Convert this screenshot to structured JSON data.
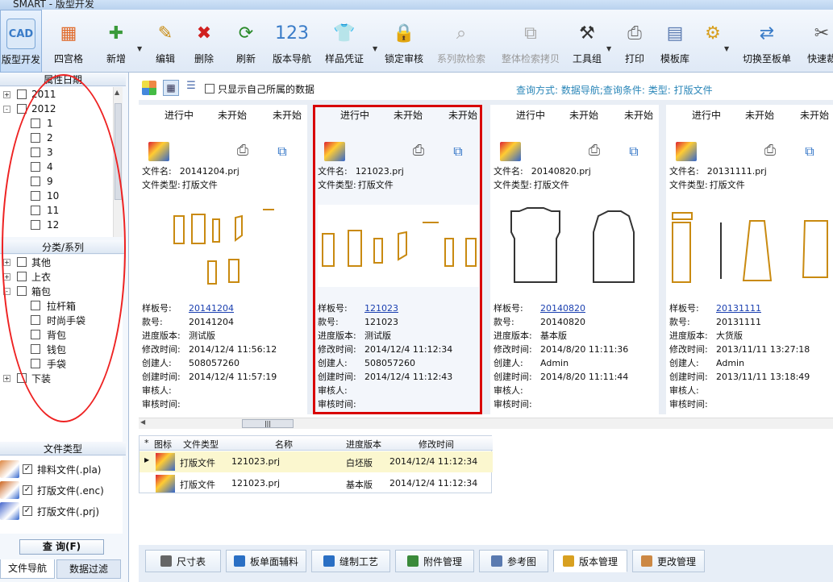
{
  "window": {
    "title": "SMART - 版型开发"
  },
  "toolbar": [
    {
      "label": "版型开发",
      "icon": "cad-icon",
      "active": true
    },
    {
      "label": "四宫格",
      "icon": "grid-four-icon"
    },
    {
      "label": "新增",
      "icon": "new-doc-icon"
    },
    {
      "label": "编辑",
      "icon": "edit-icon"
    },
    {
      "label": "删除",
      "icon": "delete-icon"
    },
    {
      "label": "刷新",
      "icon": "refresh-icon"
    },
    {
      "label": "版本导航",
      "icon": "version-nav-icon"
    },
    {
      "label": "样品凭证",
      "icon": "shirt-icon"
    },
    {
      "label": "锁定审核",
      "icon": "lock-icon"
    },
    {
      "label": "系列款检索",
      "icon": "series-search-icon",
      "disabled": true
    },
    {
      "label": "整体检索拷贝",
      "icon": "copy-icon",
      "disabled": true
    },
    {
      "label": "工具组",
      "icon": "tools-icon"
    },
    {
      "label": "打印",
      "icon": "printer-icon"
    },
    {
      "label": "模板库",
      "icon": "template-icon"
    },
    {
      "label": "",
      "icon": "gear-icon"
    },
    {
      "label": "切换至板单",
      "icon": "switch-icon"
    },
    {
      "label": "快速裁",
      "icon": "scissors-icon"
    }
  ],
  "left": {
    "attr_date_title": "属性日期",
    "date_tree": [
      {
        "label": "2011",
        "level": 0,
        "expander": "+"
      },
      {
        "label": "2012",
        "level": 0,
        "expander": "-"
      },
      {
        "label": "1",
        "level": 1
      },
      {
        "label": "2",
        "level": 1
      },
      {
        "label": "3",
        "level": 1
      },
      {
        "label": "4",
        "level": 1
      },
      {
        "label": "9",
        "level": 1
      },
      {
        "label": "10",
        "level": 1
      },
      {
        "label": "11",
        "level": 1
      },
      {
        "label": "12",
        "level": 1
      }
    ],
    "category_title": "分类/系列",
    "category_tree": [
      {
        "label": "其他",
        "level": 0,
        "expander": "+"
      },
      {
        "label": "上衣",
        "level": 0,
        "expander": "+"
      },
      {
        "label": "箱包",
        "level": 0,
        "expander": "-"
      },
      {
        "label": "拉杆箱",
        "level": 1
      },
      {
        "label": "时尚手袋",
        "level": 1
      },
      {
        "label": "背包",
        "level": 1
      },
      {
        "label": "钱包",
        "level": 1
      },
      {
        "label": "手袋",
        "level": 1
      },
      {
        "label": "下装",
        "level": 0,
        "expander": "+"
      }
    ],
    "filetype_title": "文件类型",
    "file_types": [
      {
        "label": "排料文件(.pla)",
        "checked": true,
        "check_mark": "✓"
      },
      {
        "label": "打版文件(.enc)",
        "checked": true,
        "check_mark": "✓"
      },
      {
        "label": "打版文件(.prj)",
        "checked": true,
        "check_mark": "✓"
      }
    ],
    "query_button": "查 询(F)",
    "tabs": [
      "文件导航",
      "数据过滤"
    ]
  },
  "main": {
    "own_data_label": "只显示自己所属的数据",
    "query_info": "查询方式: 数据导航;查询条件: 类型: 打版文件",
    "cards": [
      {
        "status": [
          "进行中",
          "未开始",
          "未开始"
        ],
        "filename_label": "文件名:",
        "filename": "20141204.prj",
        "filetype_label": "文件类型:",
        "filetype": "打版文件",
        "fields": [
          [
            "样板号:",
            "20141204"
          ],
          [
            "款号:",
            "20141204"
          ],
          [
            "进度版本:",
            "测试版"
          ],
          [
            "修改时间:",
            "2014/12/4 11:56:12"
          ],
          [
            "创建人:",
            "508057260"
          ],
          [
            "创建时间:",
            "2014/12/4 11:57:19"
          ],
          [
            "审核人:",
            ""
          ],
          [
            "审核时间:",
            ""
          ]
        ]
      },
      {
        "status": [
          "进行中",
          "未开始",
          "未开始"
        ],
        "filename_label": "文件名:",
        "filename": "121023.prj",
        "filetype_label": "文件类型:",
        "filetype": "打版文件",
        "selected": true,
        "fields": [
          [
            "样板号:",
            "121023"
          ],
          [
            "款号:",
            "121023"
          ],
          [
            "进度版本:",
            "测试版"
          ],
          [
            "修改时间:",
            "2014/12/4 11:12:34"
          ],
          [
            "创建人:",
            "508057260"
          ],
          [
            "创建时间:",
            "2014/12/4 11:12:43"
          ],
          [
            "审核人:",
            ""
          ],
          [
            "审核时间:",
            ""
          ]
        ]
      },
      {
        "status": [
          "进行中",
          "未开始",
          "未开始"
        ],
        "filename_label": "文件名:",
        "filename": "20140820.prj",
        "filetype_label": "文件类型:",
        "filetype": "打版文件",
        "fields": [
          [
            "样板号:",
            "20140820"
          ],
          [
            "款号:",
            "20140820"
          ],
          [
            "进度版本:",
            "基本版"
          ],
          [
            "修改时间:",
            "2014/8/20 11:11:36"
          ],
          [
            "创建人:",
            "Admin"
          ],
          [
            "创建时间:",
            "2014/8/20 11:11:44"
          ],
          [
            "审核人:",
            ""
          ],
          [
            "审核时间:",
            ""
          ]
        ]
      },
      {
        "status": [
          "进行中",
          "未开始",
          "未开始"
        ],
        "filename_label": "文件名:",
        "filename": "20131111.prj",
        "filetype_label": "文件类型:",
        "filetype": "打版文件",
        "fields": [
          [
            "样板号:",
            "20131111"
          ],
          [
            "款号:",
            "20131111"
          ],
          [
            "进度版本:",
            "大货版"
          ],
          [
            "修改时间:",
            "2013/11/11 13:27:18"
          ],
          [
            "创建人:",
            "Admin"
          ],
          [
            "创建时间:",
            "2013/11/11 13:18:49"
          ],
          [
            "审核人:",
            ""
          ],
          [
            "审核时间:",
            ""
          ]
        ]
      }
    ],
    "grid": {
      "corner": "*",
      "headers": [
        "图标",
        "文件类型",
        "名称",
        "进度版本",
        "修改时间"
      ],
      "rows": [
        {
          "type": "打版文件",
          "name": "121023.prj",
          "version": "白坯版",
          "time": "2014/12/4 11:12:34",
          "current": true
        },
        {
          "type": "打版文件",
          "name": "121023.prj",
          "version": "基本版",
          "time": "2014/12/4 11:12:34"
        }
      ]
    },
    "bottom_tabs": [
      "尺寸表",
      "板单面辅料",
      "缝制工艺",
      "附件管理",
      "参考图",
      "版本管理",
      "更改管理"
    ],
    "active_tab": "版本管理"
  }
}
